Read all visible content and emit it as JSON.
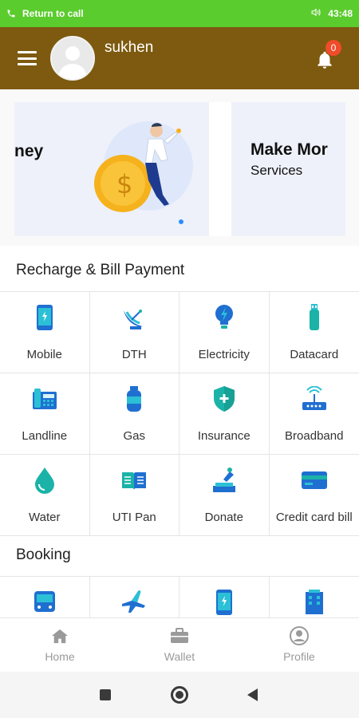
{
  "status_bar": {
    "left_text": "Return to call",
    "time": "43:48"
  },
  "header": {
    "username": "sukhen",
    "notification_count": "0"
  },
  "banner": {
    "left_text": "ney",
    "title": "Make Mor",
    "subtitle": "Services"
  },
  "recharge": {
    "title": "Recharge & Bill Payment",
    "items": [
      {
        "label": "Mobile",
        "icon": "mobile-icon"
      },
      {
        "label": "DTH",
        "icon": "satellite-dish-icon"
      },
      {
        "label": "Electricity",
        "icon": "bulb-icon"
      },
      {
        "label": "Datacard",
        "icon": "usb-icon"
      },
      {
        "label": "Landline",
        "icon": "landline-phone-icon"
      },
      {
        "label": "Gas",
        "icon": "gas-cylinder-icon"
      },
      {
        "label": "Insurance",
        "icon": "shield-icon"
      },
      {
        "label": "Broadband",
        "icon": "router-icon"
      },
      {
        "label": "Water",
        "icon": "water-drop-icon"
      },
      {
        "label": "UTI Pan",
        "icon": "book-icon"
      },
      {
        "label": "Donate",
        "icon": "donation-icon"
      },
      {
        "label": "Credit card bill",
        "icon": "credit-card-icon"
      }
    ]
  },
  "booking": {
    "title": "Booking",
    "items": [
      {
        "icon": "bus-icon"
      },
      {
        "icon": "airplane-icon"
      },
      {
        "icon": "mobile-icon"
      },
      {
        "icon": "building-icon"
      }
    ]
  },
  "bottom_nav": {
    "items": [
      {
        "label": "Home",
        "icon": "home-icon"
      },
      {
        "label": "Wallet",
        "icon": "wallet-icon"
      },
      {
        "label": "Profile",
        "icon": "profile-icon"
      }
    ]
  },
  "colors": {
    "status_bar": "#5bcc2e",
    "header": "#7d5a10",
    "icon_blue": "#1f6fd1",
    "icon_teal": "#1bb3a8",
    "badge": "#f04b2a"
  }
}
